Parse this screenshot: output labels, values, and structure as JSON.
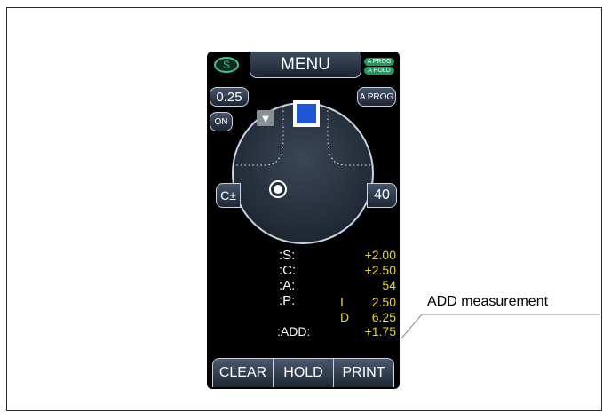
{
  "header": {
    "s_badge": "S",
    "menu_label": "MENU",
    "status_badges": [
      "A PROG",
      "A HOLD"
    ]
  },
  "controls": {
    "increment_value": "0.25",
    "on_label": "ON",
    "aprog_label": "A PROG",
    "cyl_label": "C±",
    "value_40": "40"
  },
  "readouts": {
    "s": {
      "label": ":S:",
      "value": "+2.00"
    },
    "c": {
      "label": ":C:",
      "value": "+2.50"
    },
    "a": {
      "label": ":A:",
      "value": "54"
    },
    "p": {
      "label": ":P:",
      "i_prefix": "I",
      "i_value": "2.50",
      "d_prefix": "D",
      "d_value": "6.25"
    },
    "add": {
      "label": ":ADD:",
      "value": "+1.75"
    }
  },
  "bottom_buttons": [
    "CLEAR",
    "HOLD",
    "PRINT"
  ],
  "annotation": {
    "text": "ADD measurement"
  },
  "colors": {
    "background": "#000000",
    "readout_value": "#e6d23a",
    "status_green": "#1f9b5e",
    "s_badge": "#44c08c",
    "target_blue": "#1f56d6"
  }
}
